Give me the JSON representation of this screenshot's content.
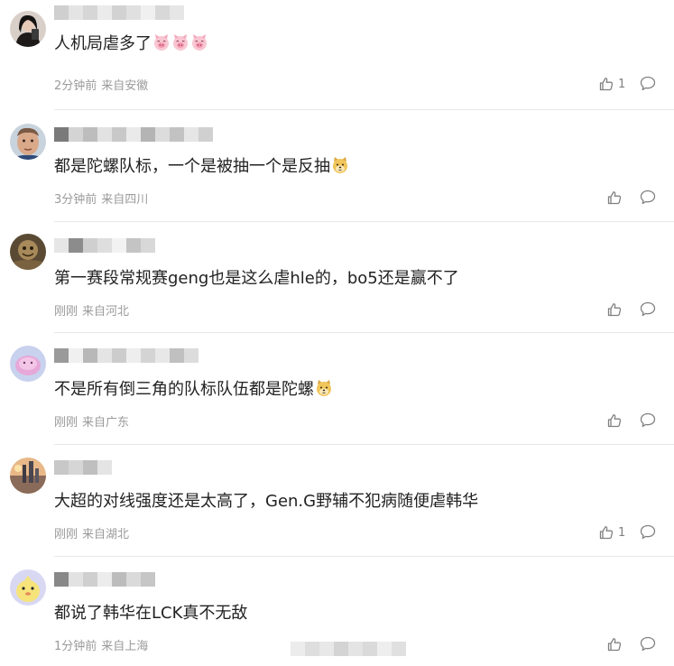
{
  "comments": [
    {
      "text": "人机局虐多了",
      "emojis": [
        "pig-face-icon",
        "pig-face-icon",
        "pig-face-icon"
      ],
      "time": "2分钟前",
      "location": "来自安徽",
      "likes": "1"
    },
    {
      "text": "都是陀螺队标，一个是被抽一个是反抽",
      "emojis": [
        "doge-icon"
      ],
      "time": "3分钟前",
      "location": "来自四川",
      "likes": ""
    },
    {
      "text": "第一赛段常规赛geng也是这么虐hle的，bo5还是赢不了",
      "emojis": [],
      "time": "刚刚",
      "location": "来自河北",
      "likes": ""
    },
    {
      "text": "不是所有倒三角的队标队伍都是陀螺",
      "emojis": [
        "doge-icon"
      ],
      "time": "刚刚",
      "location": "来自广东",
      "likes": ""
    },
    {
      "text": "大超的对线强度还是太高了，Gen.G野辅不犯病随便虐韩华",
      "emojis": [],
      "time": "刚刚",
      "location": "来自湖北",
      "likes": "1"
    },
    {
      "text": "都说了韩华在LCK真不无敌",
      "emojis": [],
      "time": "1分钟前",
      "location": "来自上海",
      "likes": ""
    }
  ],
  "colors": {
    "text": "#222222",
    "meta": "#9a9a9a",
    "divider": "#e8e8e8",
    "icon": "#808080"
  }
}
